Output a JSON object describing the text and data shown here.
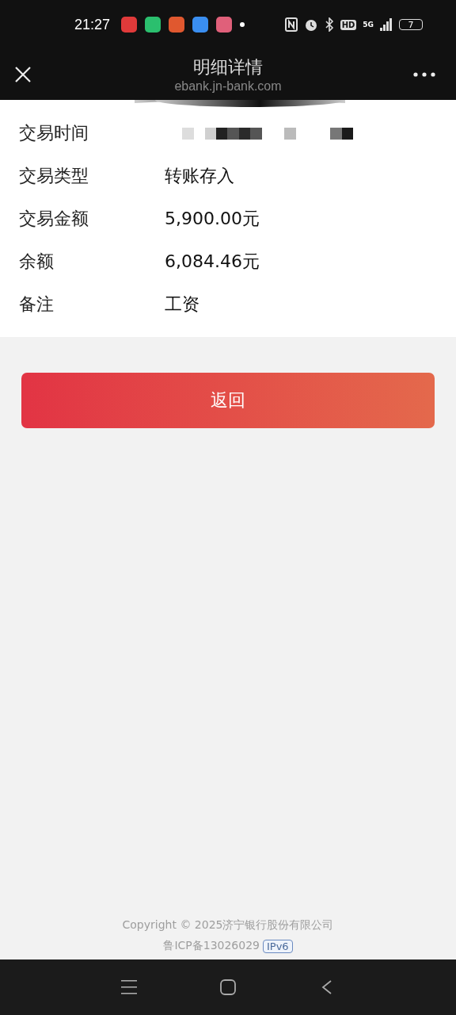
{
  "status_bar": {
    "time": "21:27",
    "hd": "HD",
    "network": "5G",
    "battery": "7"
  },
  "header": {
    "title": "明细详情",
    "subtitle": "ebank.jn-bank.com"
  },
  "details": [
    {
      "label": "交易时间",
      "kind": "redacted"
    },
    {
      "label": "交易类型",
      "kind": "text",
      "value": "转账存入"
    },
    {
      "label": "交易金额",
      "kind": "text",
      "value": "5,900.00元"
    },
    {
      "label": "余额",
      "kind": "text",
      "value": "6,084.46元"
    },
    {
      "label": "备注",
      "kind": "text",
      "value": "工资"
    }
  ],
  "back_button": "返回",
  "footer": {
    "copyright": "Copyright © 2025济宁银行股份有限公司",
    "icp": "鲁ICP备13026029",
    "badge": "IPv6"
  }
}
